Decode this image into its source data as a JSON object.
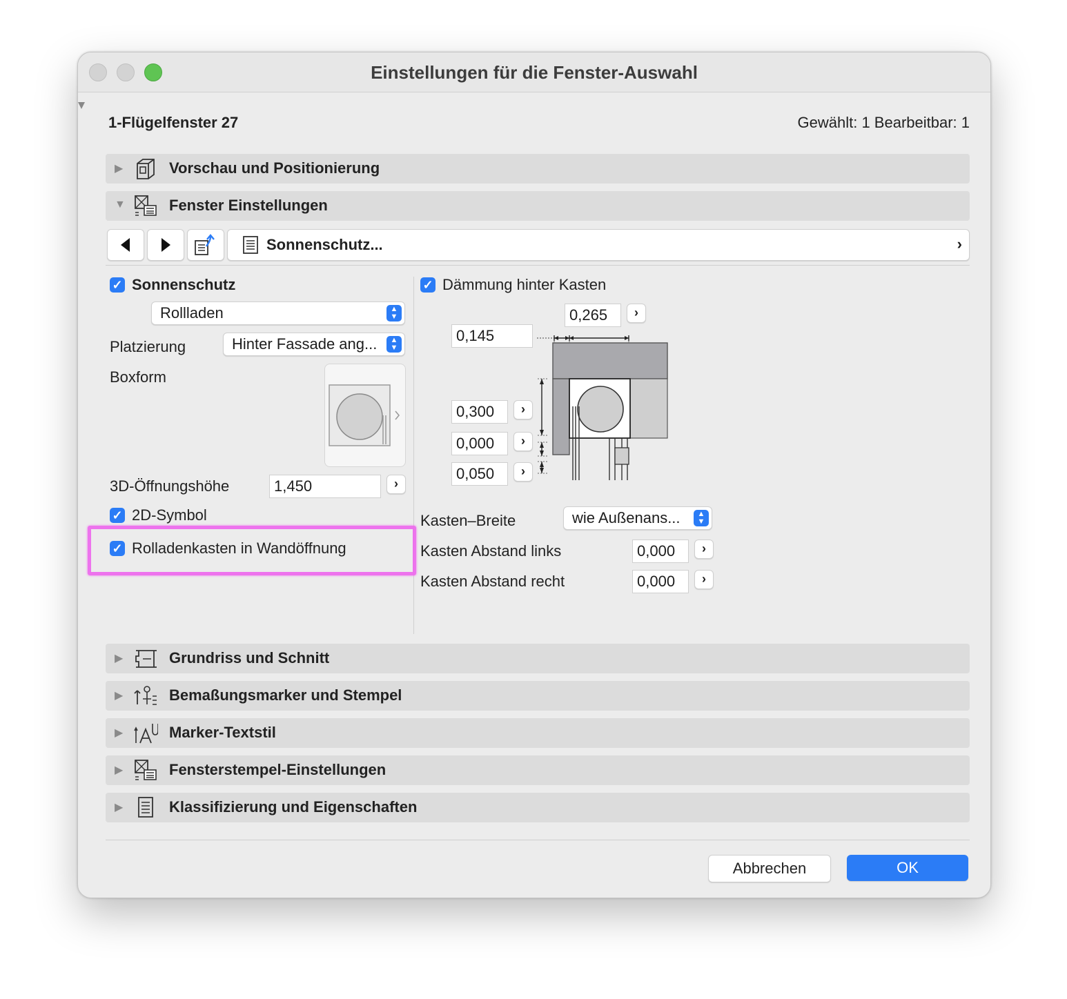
{
  "window": {
    "title": "Einstellungen für die Fenster-Auswahl",
    "element_name": "1-Flügelfenster 27",
    "selection_info": "Gewählt: 1 Bearbeitbar: 1"
  },
  "sections": {
    "preview": "Vorschau und Positionierung",
    "window_settings": "Fenster Einstellungen",
    "floorplan": "Grundriss und Schnitt",
    "dimension_markers": "Bemaßungsmarker und Stempel",
    "marker_text": "Marker-Textstil",
    "window_stamp": "Fensterstempel-Einstellungen",
    "classification": "Klassifizierung und Eigenschaften"
  },
  "toolbar": {
    "page_label": "Sonnenschutz..."
  },
  "left": {
    "sunshade_label": "Sonnenschutz",
    "type_value": "Rollladen",
    "placement_label": "Platzierung",
    "placement_value": "Hinter Fassade ang...",
    "boxform_label": "Boxform",
    "opening_height_label": "3D-Öffnungshöhe",
    "opening_height_value": "1,450",
    "symbol_2d_label": "2D-Symbol",
    "box_in_opening_label": "Rolladenkasten in Wandöffnung"
  },
  "right": {
    "insulation_label": "Dämmung hinter Kasten",
    "dim_top": "0,265",
    "dim_left": "0,145",
    "dim_1": "0,300",
    "dim_2": "0,000",
    "dim_3": "0,050",
    "box_width_label": "Kasten–Breite",
    "box_width_value": "wie Außenans...",
    "box_left_label": "Kasten Abstand links",
    "box_left_value": "0,000",
    "box_right_label": "Kasten Abstand recht",
    "box_right_value": "0,000"
  },
  "buttons": {
    "cancel": "Abbrechen",
    "ok": "OK"
  },
  "colors": {
    "accent": "#2b7cf6",
    "highlight": "#ee66ee",
    "close": "#d0d0d0",
    "zoom": "#5fc453"
  }
}
